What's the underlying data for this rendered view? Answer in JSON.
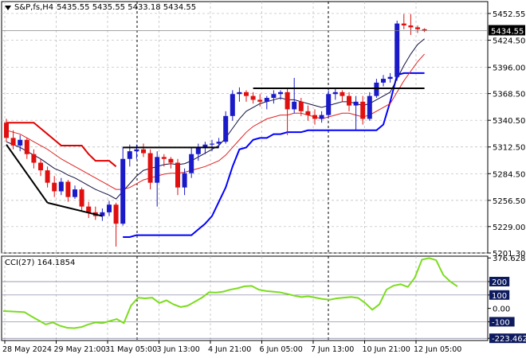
{
  "header": {
    "symbol": "S&P,fs,H4",
    "ohlc": "5435.55 5435.55 5433.18 5434.55"
  },
  "indicator": {
    "label": "CCI(27) 164.1854"
  },
  "colors": {
    "bull_candle": "#1a1ac8",
    "bear_candle": "#e01010",
    "support": "#0000ff",
    "resistance": "#e00000",
    "trendline": "#000000",
    "cci": "#7cdc1e",
    "ma_black": "#101040",
    "ma_red": "#e02020",
    "grid": "#b8b8b8",
    "price_tag_bg": "#000000"
  },
  "chart_data": [
    {
      "type": "candlestick",
      "title": "",
      "symbol": "S&P,fs,H4",
      "current_price": 5434.55,
      "price_tag": "5434.55",
      "price_axis_ticks": [
        "5452.55",
        "5424.50",
        "5396.00",
        "5368.50",
        "5340.50",
        "5312.50",
        "5284.50",
        "5256.50",
        "5229.00",
        "5201.30"
      ],
      "price_axis_values": [
        5452.55,
        5424.5,
        5396.0,
        5368.5,
        5340.5,
        5312.5,
        5284.5,
        5256.5,
        5229.0,
        5201.3
      ],
      "ylim": [
        5201.3,
        5460
      ],
      "time_axis_ticks": [
        "28 May 2024",
        "29 May 21:00",
        "31 May 05:00",
        "3 Jun 13:00",
        "4 Jun 21:00",
        "6 Jun 05:00",
        "7 Jun 13:00",
        "10 Jun 21:00",
        "12 Jun 05:00"
      ],
      "vertical_markers_at_tick": [
        2,
        6
      ],
      "candles": [
        [
          5338,
          5342,
          5318,
          5322
        ],
        [
          5322,
          5330,
          5310,
          5314
        ],
        [
          5314,
          5325,
          5308,
          5320
        ],
        [
          5320,
          5322,
          5300,
          5305
        ],
        [
          5305,
          5310,
          5290,
          5296
        ],
        [
          5296,
          5300,
          5282,
          5288
        ],
        [
          5288,
          5292,
          5270,
          5275
        ],
        [
          5275,
          5282,
          5260,
          5266
        ],
        [
          5266,
          5280,
          5262,
          5276
        ],
        [
          5276,
          5278,
          5255,
          5260
        ],
        [
          5260,
          5272,
          5258,
          5268
        ],
        [
          5268,
          5270,
          5245,
          5250
        ],
        [
          5250,
          5255,
          5238,
          5244
        ],
        [
          5244,
          5250,
          5236,
          5240
        ],
        [
          5240,
          5248,
          5235,
          5244
        ],
        [
          5244,
          5256,
          5240,
          5252
        ],
        [
          5252,
          5254,
          5208,
          5232
        ],
        [
          5232,
          5312,
          5230,
          5300
        ],
        [
          5300,
          5315,
          5292,
          5308
        ],
        [
          5308,
          5315,
          5300,
          5310
        ],
        [
          5310,
          5316,
          5302,
          5306
        ],
        [
          5306,
          5310,
          5268,
          5275
        ],
        [
          5275,
          5308,
          5250,
          5302
        ],
        [
          5302,
          5305,
          5292,
          5300
        ],
        [
          5300,
          5302,
          5290,
          5296
        ],
        [
          5296,
          5300,
          5262,
          5270
        ],
        [
          5270,
          5290,
          5262,
          5285
        ],
        [
          5285,
          5312,
          5280,
          5305
        ],
        [
          5305,
          5316,
          5298,
          5312
        ],
        [
          5312,
          5318,
          5305,
          5315
        ],
        [
          5315,
          5320,
          5308,
          5316
        ],
        [
          5316,
          5322,
          5312,
          5318
        ],
        [
          5318,
          5350,
          5316,
          5345
        ],
        [
          5345,
          5372,
          5340,
          5368
        ],
        [
          5368,
          5375,
          5360,
          5370
        ],
        [
          5370,
          5372,
          5360,
          5366
        ],
        [
          5366,
          5370,
          5358,
          5362
        ],
        [
          5362,
          5368,
          5355,
          5360
        ],
        [
          5360,
          5366,
          5352,
          5364
        ],
        [
          5364,
          5372,
          5358,
          5368
        ],
        [
          5368,
          5372,
          5362,
          5370
        ],
        [
          5370,
          5374,
          5325,
          5352
        ],
        [
          5352,
          5385,
          5348,
          5360
        ],
        [
          5360,
          5364,
          5345,
          5350
        ],
        [
          5350,
          5356,
          5340,
          5346
        ],
        [
          5346,
          5352,
          5336,
          5342
        ],
        [
          5342,
          5350,
          5338,
          5346
        ],
        [
          5346,
          5372,
          5344,
          5368
        ],
        [
          5368,
          5374,
          5362,
          5370
        ],
        [
          5370,
          5372,
          5360,
          5366
        ],
        [
          5366,
          5370,
          5350,
          5356
        ],
        [
          5356,
          5366,
          5330,
          5360
        ],
        [
          5360,
          5366,
          5336,
          5342
        ],
        [
          5342,
          5370,
          5340,
          5366
        ],
        [
          5366,
          5384,
          5364,
          5380
        ],
        [
          5380,
          5388,
          5376,
          5384
        ],
        [
          5384,
          5390,
          5380,
          5386
        ],
        [
          5386,
          5445,
          5382,
          5442
        ],
        [
          5442,
          5452,
          5436,
          5440
        ],
        [
          5440,
          5452,
          5430,
          5438
        ],
        [
          5438,
          5440,
          5432,
          5436
        ],
        [
          5436,
          5437,
          5433,
          5434.55
        ]
      ],
      "ma_black": [
        5318,
        5315,
        5312,
        5308,
        5304,
        5300,
        5295,
        5290,
        5287,
        5283,
        5280,
        5276,
        5272,
        5268,
        5265,
        5262,
        5258,
        5266,
        5274,
        5282,
        5288,
        5290,
        5292,
        5294,
        5295,
        5294,
        5295,
        5298,
        5302,
        5306,
        5310,
        5314,
        5322,
        5332,
        5342,
        5350,
        5354,
        5358,
        5360,
        5362,
        5364,
        5362,
        5362,
        5360,
        5358,
        5356,
        5354,
        5356,
        5358,
        5360,
        5360,
        5358,
        5356,
        5358,
        5362,
        5366,
        5370,
        5384,
        5398,
        5410,
        5420,
        5426
      ],
      "ma_red": [
        5330,
        5328,
        5326,
        5322,
        5318,
        5314,
        5310,
        5305,
        5300,
        5296,
        5292,
        5288,
        5284,
        5280,
        5276,
        5272,
        5268,
        5268,
        5270,
        5274,
        5278,
        5280,
        5282,
        5284,
        5285,
        5285,
        5286,
        5288,
        5290,
        5292,
        5295,
        5298,
        5304,
        5312,
        5320,
        5328,
        5334,
        5338,
        5342,
        5344,
        5346,
        5346,
        5348,
        5348,
        5346,
        5344,
        5342,
        5344,
        5346,
        5348,
        5348,
        5346,
        5344,
        5346,
        5350,
        5354,
        5358,
        5370,
        5382,
        5392,
        5402,
        5410
      ],
      "support_line": [
        5338,
        5338,
        5338,
        5338,
        5338,
        5332,
        5326,
        5320,
        5314,
        5314,
        5314,
        5314,
        5305,
        5298,
        5298,
        5298,
        5292,
        5218,
        5218,
        5220,
        5220,
        5220,
        5220,
        5220,
        5220,
        5220,
        5220,
        5220,
        5226,
        5232,
        5240,
        5255,
        5270,
        5292,
        5310,
        5312,
        5320,
        5322,
        5322,
        5326,
        5326,
        5328,
        5328,
        5328,
        5330,
        5330,
        5330,
        5330,
        5330,
        5330,
        5330,
        5330,
        5330,
        5330,
        5330,
        5336,
        5360,
        5388,
        5390,
        5390,
        5390,
        5390
      ],
      "support_start": 17,
      "resistance_line": [
        5338,
        5338,
        5338,
        5338,
        5338,
        5332,
        5326,
        5320,
        5314,
        5314,
        5314,
        5314,
        5305,
        5298,
        5298,
        5298,
        5292
      ],
      "trendlines": [
        {
          "x": [
            0,
            6
          ],
          "y": [
            5315,
            5254
          ]
        },
        {
          "x": [
            6,
            14
          ],
          "y": [
            5254,
            5240
          ]
        },
        {
          "x": [
            17,
            31
          ],
          "y": [
            5312,
            5312
          ]
        },
        {
          "x": [
            36,
            61
          ],
          "y": [
            5374,
            5374
          ]
        }
      ]
    },
    {
      "type": "line",
      "name": "CCI(27) 164.1854",
      "value": 164.1854,
      "ylim": [
        -240,
        390
      ],
      "axis_ticks": [
        "376.6283",
        "200",
        "100",
        "0.00",
        "-100",
        "-223.4621"
      ],
      "axis_values": [
        376.6283,
        200,
        100,
        0,
        -100,
        -223.4621
      ],
      "boxed_ticks": [
        "200",
        "100",
        "-100",
        "-223.4621"
      ],
      "values": [
        -20,
        -22,
        -25,
        -28,
        -60,
        -90,
        -120,
        -105,
        -130,
        -145,
        -148,
        -140,
        -120,
        -105,
        -110,
        -95,
        -80,
        -110,
        20,
        80,
        75,
        80,
        40,
        60,
        30,
        10,
        20,
        50,
        80,
        120,
        118,
        125,
        140,
        150,
        165,
        168,
        140,
        130,
        125,
        120,
        108,
        95,
        85,
        90,
        80,
        70,
        65,
        75,
        80,
        85,
        78,
        40,
        -10,
        30,
        140,
        170,
        180,
        160,
        230,
        364,
        376,
        360,
        250,
        200,
        164
      ]
    }
  ]
}
